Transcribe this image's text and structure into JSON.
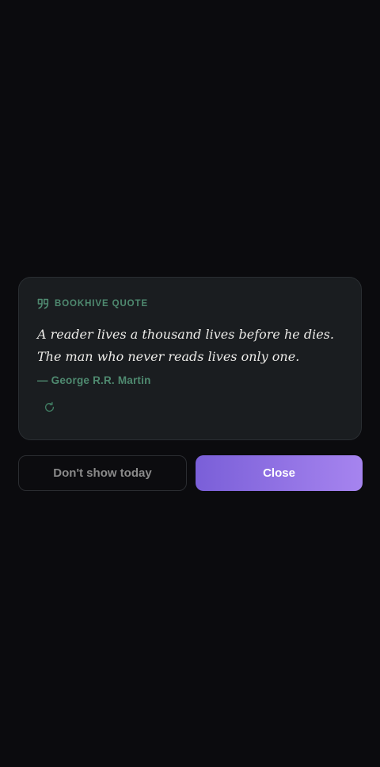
{
  "card": {
    "label": "BOOKHIVE QUOTE",
    "quote": "A reader lives a thousand lives before he dies. The man who never reads lives only one.",
    "author": "— George R.R. Martin",
    "header_icon": "quote-icon",
    "refresh_icon": "refresh-icon"
  },
  "actions": {
    "dismiss_label": "Don't show today",
    "close_label": "Close"
  },
  "colors": {
    "background": "#0b0b0e",
    "card": "#1a1d20",
    "accent_green": "#4f8a70",
    "primary_gradient_start": "#7a5fd8",
    "primary_gradient_end": "#a684ef"
  }
}
